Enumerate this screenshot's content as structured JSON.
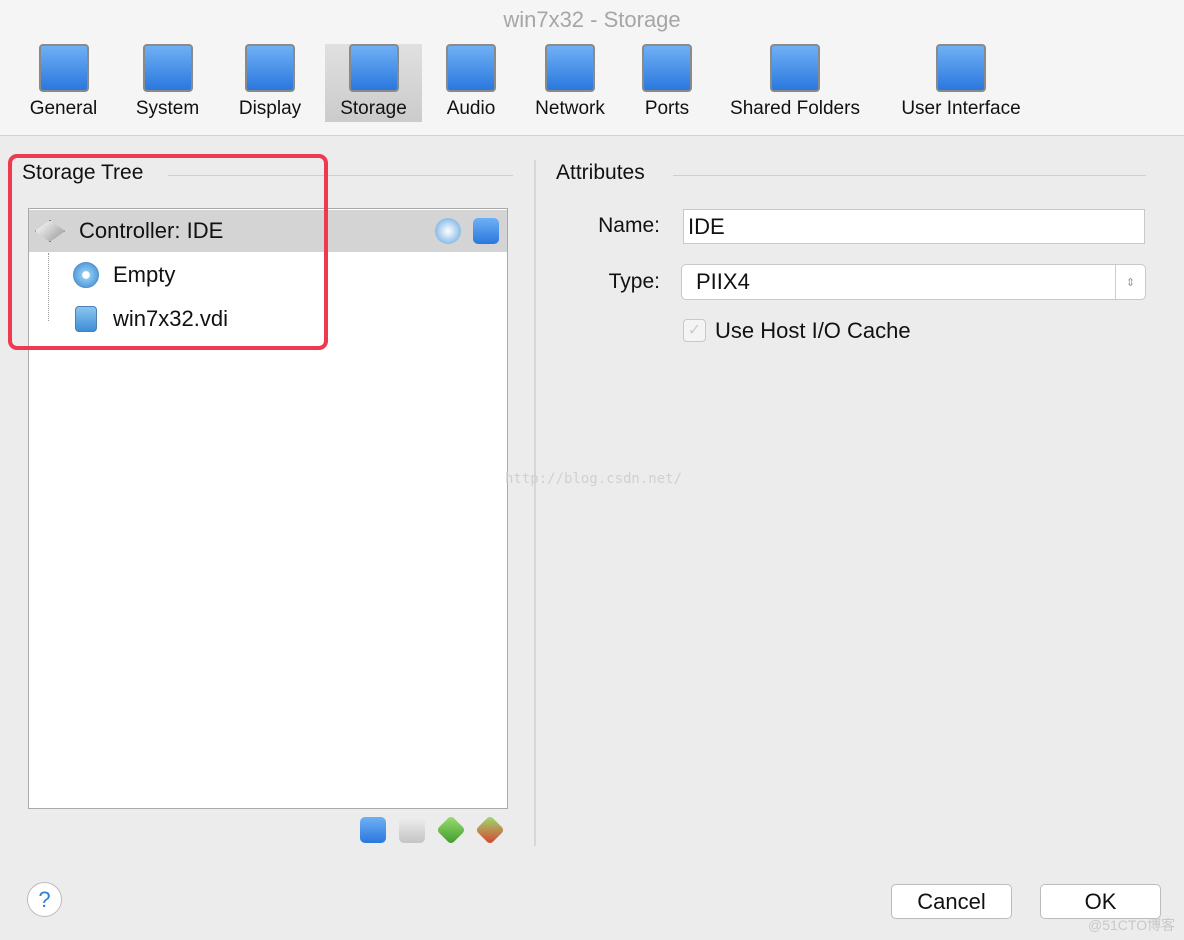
{
  "window": {
    "title": "win7x32 - Storage"
  },
  "toolbar": {
    "tabs": [
      {
        "label": "General",
        "icon": "general-icon",
        "selected": false
      },
      {
        "label": "System",
        "icon": "system-icon",
        "selected": false
      },
      {
        "label": "Display",
        "icon": "display-icon",
        "selected": false
      },
      {
        "label": "Storage",
        "icon": "storage-icon",
        "selected": true
      },
      {
        "label": "Audio",
        "icon": "audio-icon",
        "selected": false
      },
      {
        "label": "Network",
        "icon": "network-icon",
        "selected": false
      },
      {
        "label": "Ports",
        "icon": "ports-icon",
        "selected": false
      },
      {
        "label": "Shared Folders",
        "icon": "shared-folders-icon",
        "selected": false
      },
      {
        "label": "User Interface",
        "icon": "user-interface-icon",
        "selected": false
      }
    ]
  },
  "storage_tree": {
    "title": "Storage Tree",
    "controller": "Controller: IDE",
    "items": [
      {
        "label": "Empty",
        "icon": "optical-disc-icon"
      },
      {
        "label": "win7x32.vdi",
        "icon": "hard-disk-icon"
      }
    ]
  },
  "attributes": {
    "title": "Attributes",
    "name_label": "Name:",
    "name_value": "IDE",
    "type_label": "Type:",
    "type_value": "PIIX4",
    "cache_label": "Use Host I/O Cache",
    "cache_checked": false
  },
  "footer": {
    "help": "?",
    "cancel": "Cancel",
    "ok": "OK"
  },
  "watermark": {
    "center": "http://blog.csdn.net/",
    "corner": "@51CTO博客"
  },
  "colors": {
    "highlight": "#ee3a4f",
    "selected_row": "#d4d4d4"
  }
}
